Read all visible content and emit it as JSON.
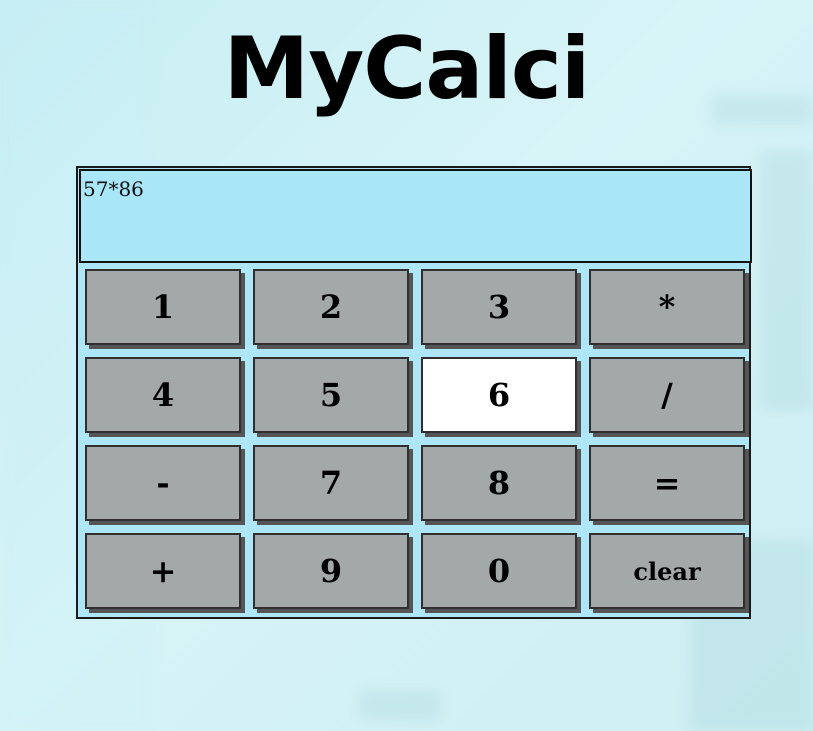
{
  "app": {
    "title": "MyCalci"
  },
  "display": {
    "value": "57*86"
  },
  "keys": [
    {
      "label": "1",
      "name": "key-1"
    },
    {
      "label": "2",
      "name": "key-2"
    },
    {
      "label": "3",
      "name": "key-3"
    },
    {
      "label": "*",
      "name": "key-multiply"
    },
    {
      "label": "4",
      "name": "key-4"
    },
    {
      "label": "5",
      "name": "key-5"
    },
    {
      "label": "6",
      "name": "key-6",
      "state": "active"
    },
    {
      "label": "/",
      "name": "key-divide"
    },
    {
      "label": "-",
      "name": "key-subtract"
    },
    {
      "label": "7",
      "name": "key-7"
    },
    {
      "label": "8",
      "name": "key-8"
    },
    {
      "label": "=",
      "name": "key-equals"
    },
    {
      "label": "+",
      "name": "key-add"
    },
    {
      "label": "9",
      "name": "key-9"
    },
    {
      "label": "0",
      "name": "key-0"
    },
    {
      "label": "clear",
      "name": "key-clear"
    }
  ],
  "colors": {
    "background": "#c9eff4",
    "display_bg": "#a8e6f8",
    "key_bg": "#a3a8a8",
    "key_active_bg": "#ffffff",
    "key_shadow": "#555555"
  }
}
